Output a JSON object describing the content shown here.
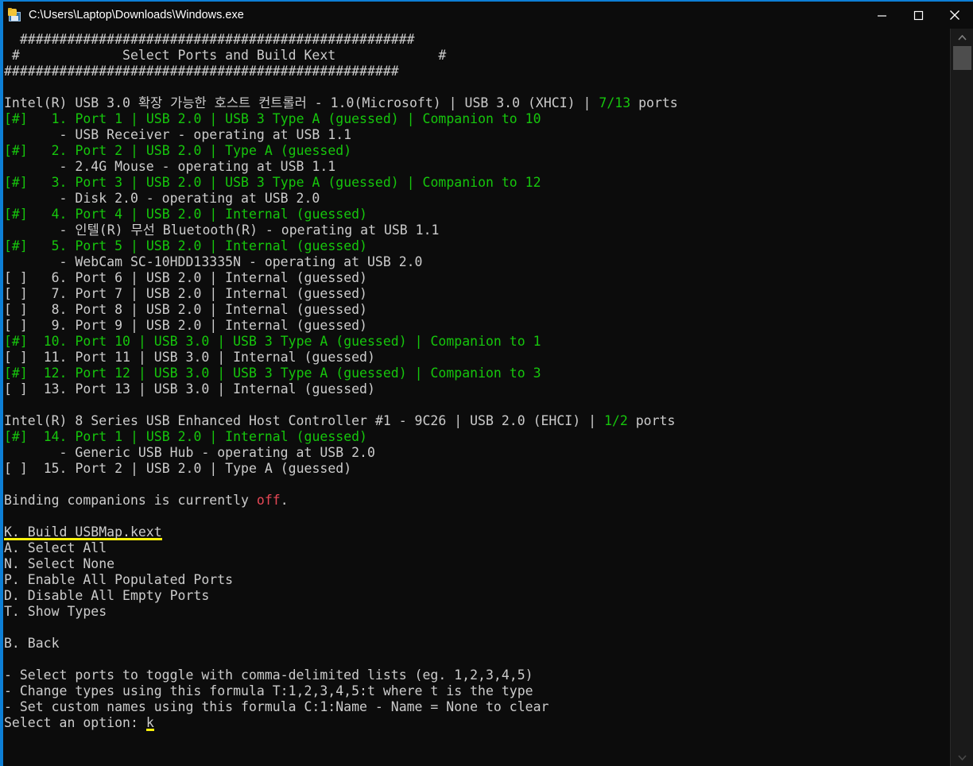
{
  "window": {
    "title": "C:\\Users\\Laptop\\Downloads\\Windows.exe",
    "icon": "app-disk-icon",
    "minimize_label": "Minimize",
    "maximize_label": "Maximize",
    "close_label": "Close",
    "accent_color": "#0d7fd6",
    "background": "#0c0c0c"
  },
  "colors": {
    "text": "#cccccc",
    "selected": "#16c60c",
    "off": "#e74856",
    "highlight": "#f9f10b"
  },
  "terminal": {
    "banner": {
      "top": "  ##################################################",
      "middle_left": " #",
      "middle_title": "Select Ports and Build Kext",
      "middle_right": "#",
      "middle": " #             Select Ports and Build Kext             #",
      "bottom": "##################################################"
    },
    "controllers": [
      {
        "name": "Intel(R) USB 3.0 확장 가능한 호스트 컨트롤러 - 1.0(Microsoft) | USB 3.0 (XHCI) | ",
        "ports_count": "7/13",
        "ports_suffix": " ports",
        "ports": [
          {
            "check": "[#]",
            "selected": true,
            "num": " 1.",
            "desc": "Port 1 | USB 2.0 | USB 3 Type A (guessed) | Companion to 10",
            "device": "       - USB Receiver - operating at USB 1.1"
          },
          {
            "check": "[#]",
            "selected": true,
            "num": " 2.",
            "desc": "Port 2 | USB 2.0 | Type A (guessed)",
            "device": "       - 2.4G Mouse - operating at USB 1.1"
          },
          {
            "check": "[#]",
            "selected": true,
            "num": " 3.",
            "desc": "Port 3 | USB 2.0 | USB 3 Type A (guessed) | Companion to 12",
            "device": "       - Disk 2.0 - operating at USB 2.0"
          },
          {
            "check": "[#]",
            "selected": true,
            "num": " 4.",
            "desc": "Port 4 | USB 2.0 | Internal (guessed)",
            "device": "       - 인텔(R) 무선 Bluetooth(R) - operating at USB 1.1"
          },
          {
            "check": "[#]",
            "selected": true,
            "num": " 5.",
            "desc": "Port 5 | USB 2.0 | Internal (guessed)",
            "device": "       - WebCam SC-10HDD13335N - operating at USB 2.0"
          },
          {
            "check": "[ ]",
            "selected": false,
            "num": " 6.",
            "desc": "Port 6 | USB 2.0 | Internal (guessed)",
            "device": ""
          },
          {
            "check": "[ ]",
            "selected": false,
            "num": " 7.",
            "desc": "Port 7 | USB 2.0 | Internal (guessed)",
            "device": ""
          },
          {
            "check": "[ ]",
            "selected": false,
            "num": " 8.",
            "desc": "Port 8 | USB 2.0 | Internal (guessed)",
            "device": ""
          },
          {
            "check": "[ ]",
            "selected": false,
            "num": " 9.",
            "desc": "Port 9 | USB 2.0 | Internal (guessed)",
            "device": ""
          },
          {
            "check": "[#]",
            "selected": true,
            "num": "10.",
            "desc": "Port 10 | USB 3.0 | USB 3 Type A (guessed) | Companion to 1",
            "device": ""
          },
          {
            "check": "[ ]",
            "selected": false,
            "num": "11.",
            "desc": "Port 11 | USB 3.0 | Internal (guessed)",
            "device": ""
          },
          {
            "check": "[#]",
            "selected": true,
            "num": "12.",
            "desc": "Port 12 | USB 3.0 | USB 3 Type A (guessed) | Companion to 3",
            "device": ""
          },
          {
            "check": "[ ]",
            "selected": false,
            "num": "13.",
            "desc": "Port 13 | USB 3.0 | Internal (guessed)",
            "device": ""
          }
        ]
      },
      {
        "name": "Intel(R) 8 Series USB Enhanced Host Controller #1 - 9C26 | USB 2.0 (EHCI) | ",
        "ports_count": "1/2",
        "ports_suffix": " ports",
        "ports": [
          {
            "check": "[#]",
            "selected": true,
            "num": "14.",
            "desc": "Port 1 | USB 2.0 | Internal (guessed)",
            "device": "       - Generic USB Hub - operating at USB 2.0"
          },
          {
            "check": "[ ]",
            "selected": false,
            "num": "15.",
            "desc": "Port 2 | USB 2.0 | Type A (guessed)",
            "device": ""
          }
        ]
      }
    ],
    "binding": {
      "prefix": "Binding companions is currently ",
      "state": "off",
      "suffix": "."
    },
    "menu": [
      {
        "key": "K.",
        "label": "Build USBMap.kext",
        "highlighted": true,
        "text": "K. Build USBMap.kext"
      },
      {
        "key": "A.",
        "label": "Select All",
        "highlighted": false,
        "text": "A. Select All"
      },
      {
        "key": "N.",
        "label": "Select None",
        "highlighted": false,
        "text": "N. Select None"
      },
      {
        "key": "P.",
        "label": "Enable All Populated Ports",
        "highlighted": false,
        "text": "P. Enable All Populated Ports"
      },
      {
        "key": "D.",
        "label": "Disable All Empty Ports",
        "highlighted": false,
        "text": "D. Disable All Empty Ports"
      },
      {
        "key": "T.",
        "label": "Show Types",
        "highlighted": false,
        "text": "T. Show Types"
      }
    ],
    "back": {
      "key": "B.",
      "label": "Back",
      "text": "B. Back"
    },
    "hints": [
      "- Select ports to toggle with comma-delimited lists (eg. 1,2,3,4,5)",
      "- Change types using this formula T:1,2,3,4,5:t where t is the type",
      "- Set custom names using this formula C:1:Name - Name = None to clear"
    ],
    "prompt": {
      "label": "Select an option: ",
      "input": "k"
    }
  },
  "scrollbar": {
    "up_arrow": "▲",
    "down_arrow": "▼"
  }
}
